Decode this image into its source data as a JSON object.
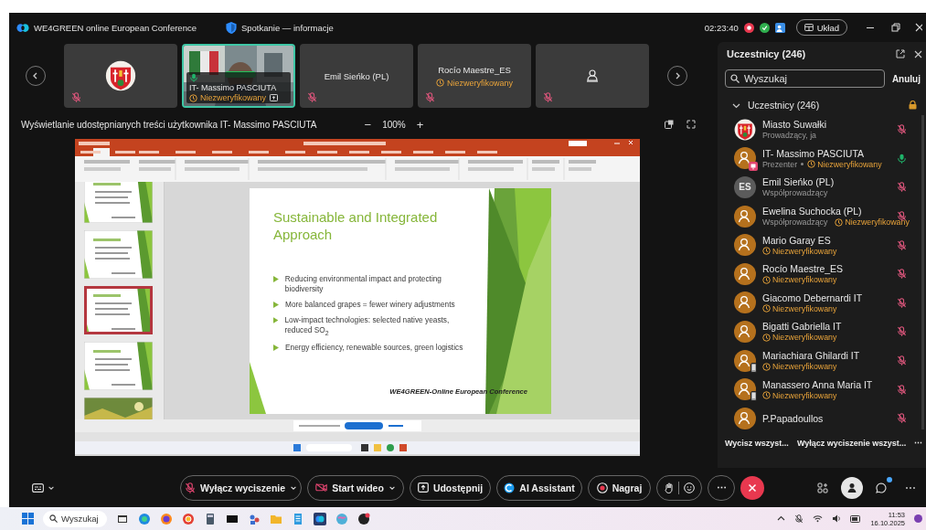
{
  "title_bar": {
    "app_title": "WE4GREEN online European Conference",
    "meeting_info": "Spotkanie — informacje",
    "timer": "02:23:40",
    "layout_button": "Układ"
  },
  "video_strip": {
    "tiles": [
      {
        "kind": "emblem",
        "selected": false,
        "muted": true
      },
      {
        "kind": "video",
        "selected": true,
        "muted": false,
        "name": "IT- Massimo PASCIUTA",
        "status": "Niezweryfikowany"
      },
      {
        "kind": "name",
        "selected": false,
        "muted": true,
        "name": "Emil Sieńko (PL)"
      },
      {
        "kind": "name",
        "selected": false,
        "muted": true,
        "name": "Rocío Maestre_ES",
        "status": "Niezweryfikowany"
      },
      {
        "kind": "avatar",
        "selected": false,
        "muted": true
      }
    ]
  },
  "sharing": {
    "label": "Wyświetlanie udostępnianych treści użytkownika IT- Massimo PASCIUTA",
    "zoom_out": "−",
    "zoom": "100%",
    "zoom_in": "+"
  },
  "shared_screen": {
    "thumbnails": [
      {
        "kind": "text",
        "selected": false
      },
      {
        "kind": "text",
        "selected": false
      },
      {
        "kind": "text",
        "selected": true
      },
      {
        "kind": "text",
        "selected": false
      },
      {
        "kind": "picture",
        "selected": false
      }
    ],
    "slide": {
      "title": "Sustainable and Integrated Approach",
      "bullets": [
        "Reducing environmental impact and protecting biodiversity",
        "More balanced grapes = fewer winery adjustments",
        "Low-impact technologies: selected native yeasts, reduced SO$_{2}$",
        "Energy efficiency, renewable sources, green logistics"
      ],
      "footer": "WE4GREEN-Online European Conference"
    }
  },
  "participants_panel": {
    "title": "Uczestnicy (246)",
    "search": {
      "placeholder": "Wyszukaj"
    },
    "cancel": "Anuluj",
    "group": {
      "label": "Uczestnicy (246)",
      "expanded": true
    },
    "participants": [
      {
        "kind": "emblem",
        "name": "Miasto Suwałki",
        "role": "Prowadzący, ja",
        "muted": true
      },
      {
        "kind": "person",
        "presenter": true,
        "on_phone": false,
        "name": "IT- Massimo PASCIUTA",
        "role": "Prezenter",
        "status": "Niezweryfikowany",
        "muted": false
      },
      {
        "kind": "initials",
        "initials": "ES",
        "name": "Emil Sieńko (PL)",
        "role": "Współprowadzący",
        "muted": true
      },
      {
        "kind": "person",
        "presenter": false,
        "on_phone": false,
        "name": "Ewelina Suchocka (PL)",
        "role": "Współprowadzący",
        "status": "Niezweryfikowany",
        "muted": true
      },
      {
        "kind": "person",
        "presenter": false,
        "on_phone": false,
        "name": "Mario Garay ES",
        "status": "Niezweryfikowany",
        "muted": true
      },
      {
        "kind": "person",
        "presenter": false,
        "on_phone": false,
        "name": "Rocío Maestre_ES",
        "status": "Niezweryfikowany",
        "muted": true
      },
      {
        "kind": "person",
        "presenter": false,
        "on_phone": false,
        "name": "Giacomo Debernardi IT",
        "status": "Niezweryfikowany",
        "muted": true
      },
      {
        "kind": "person",
        "presenter": false,
        "on_phone": false,
        "name": "Bigatti Gabriella IT",
        "status": "Niezweryfikowany",
        "muted": true
      },
      {
        "kind": "person",
        "presenter": false,
        "on_phone": true,
        "name": "Mariachiara Ghilardi IT",
        "status": "Niezweryfikowany",
        "muted": true
      },
      {
        "kind": "person",
        "presenter": false,
        "on_phone": true,
        "name": "Manassero Anna Maria IT",
        "status": "Niezweryfikowany",
        "muted": true
      },
      {
        "kind": "person",
        "presenter": false,
        "on_phone": false,
        "name": "P.Papadoullos",
        "muted": true
      }
    ],
    "footer": [
      "Wycisz wszyst...",
      "Wyłącz wyciszenie wszyst...",
      "⋯"
    ]
  },
  "toolbar": {
    "controls": [
      {
        "kind": "dropdown",
        "label": "Wyłącz wyciszenie"
      },
      {
        "kind": "dropdown",
        "label": "Start wideo"
      },
      {
        "kind": "button",
        "label": "Udostępnij"
      },
      {
        "kind": "button",
        "label": "AI Assistant"
      },
      {
        "kind": "button",
        "label": "Nagraj"
      },
      {
        "kind": "reactions"
      },
      {
        "kind": "more",
        "label": "⋯"
      },
      {
        "kind": "end"
      }
    ],
    "right": [
      {
        "kind": "apps",
        "selected": false
      },
      {
        "kind": "participants",
        "selected": true
      },
      {
        "kind": "chat",
        "selected": false
      },
      {
        "kind": "more",
        "label": "⋯",
        "selected": false
      }
    ]
  },
  "taskbar": {
    "search": {
      "placeholder": "Wyszukaj"
    },
    "time": "11:53",
    "date": "16.10.2025"
  }
}
